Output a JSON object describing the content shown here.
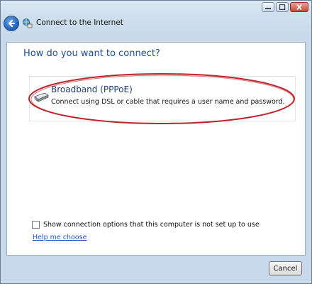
{
  "window": {
    "title": "Connect to the Internet",
    "caption_buttons": [
      "minimize-icon",
      "maximize-icon",
      "close-icon"
    ]
  },
  "content": {
    "heading": "How do you want to connect?",
    "options": [
      {
        "icon": "broadband-icon",
        "title": "Broadband (PPPoE)",
        "description": "Connect using DSL or cable that requires a user name and password."
      }
    ],
    "show_options_label": "Show connection options that this computer is not set up to use",
    "help_link": "Help me choose"
  },
  "footer": {
    "cancel_label": "Cancel"
  },
  "colors": {
    "heading": "#1a4e9a",
    "highlight_ellipse": "#c0242a",
    "link": "#1f50c8"
  }
}
